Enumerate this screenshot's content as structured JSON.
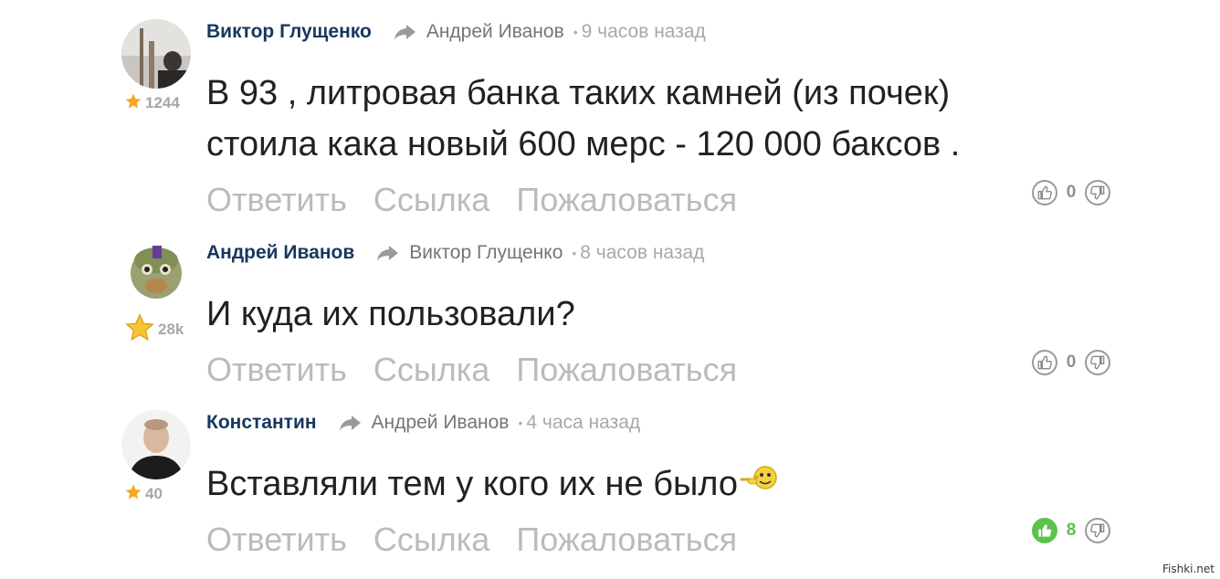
{
  "comments": [
    {
      "author": "Виктор Глущенко",
      "reply_to": "Андрей Иванов",
      "time": "9 часов назад",
      "rating": "1244",
      "text_lines": [
        "В 93 , литровая банка таких камней (из почек)",
        "стоила кака новый 600 мерс - 120 000 баксов ."
      ],
      "score": "0"
    },
    {
      "author": "Андрей Иванов",
      "reply_to": "Виктор Глущенко",
      "time": "8 часов назад",
      "rating": "28k",
      "text_lines": [
        "И куда их пользовали?"
      ],
      "score": "0"
    },
    {
      "author": "Константин",
      "reply_to": "Андрей Иванов",
      "time": "4 часа назад",
      "rating": "40",
      "text_lines": [
        "Вставляли тем у кого их не было"
      ],
      "score": "8"
    }
  ],
  "actions": {
    "reply": "Ответить",
    "link": "Ссылка",
    "report": "Пожаловаться"
  },
  "watermark": "Fishki.net",
  "colors": {
    "author": "#17375e",
    "upvote_active": "#5cc24c",
    "action_text": "#bbbbbb",
    "star": "#f5a623"
  }
}
